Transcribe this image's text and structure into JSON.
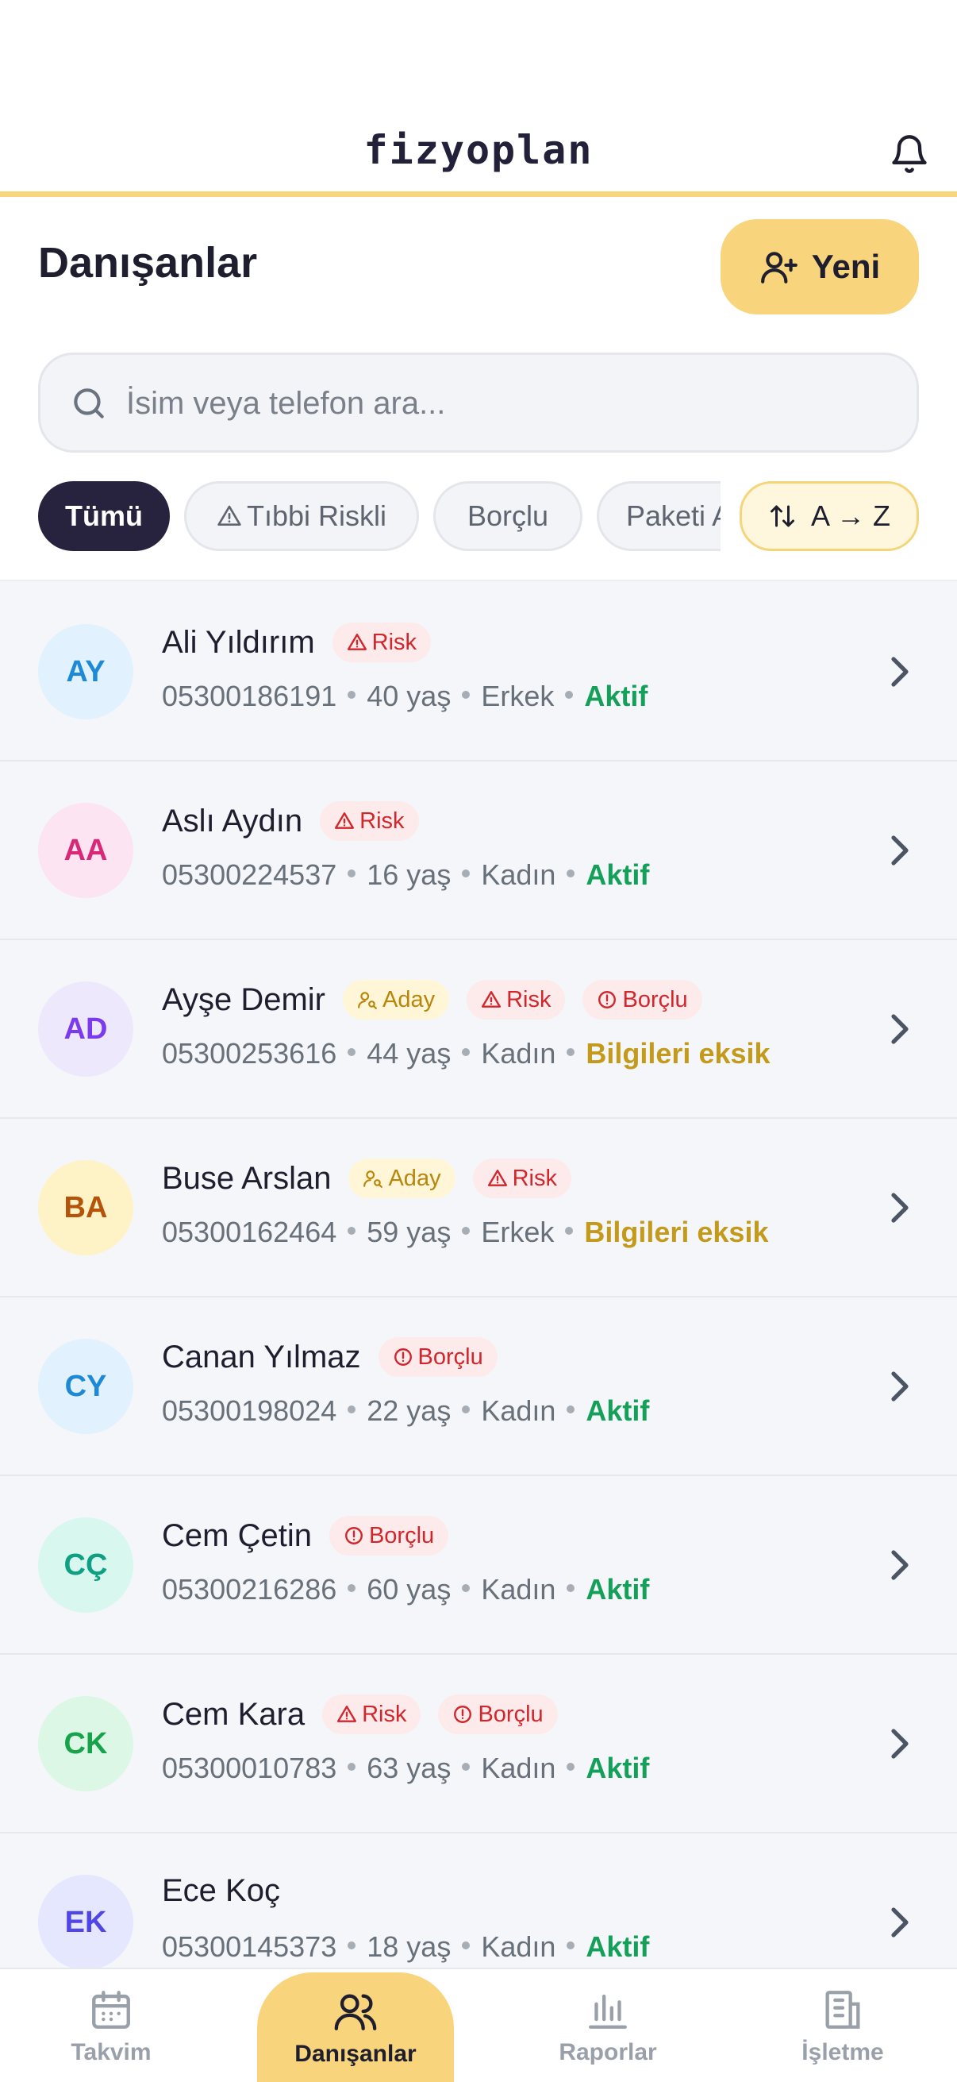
{
  "header": {
    "logo": "fizyoplan"
  },
  "title": "Danışanlar",
  "new_button": {
    "label": "Yeni"
  },
  "search": {
    "placeholder": "İsim veya telefon ara..."
  },
  "filters": [
    {
      "label": "Tümü"
    },
    {
      "label": "Tıbbi Riskli"
    },
    {
      "label": "Borçlu"
    },
    {
      "label": "Paketi Aktif"
    }
  ],
  "sort": {
    "label": "A → Z"
  },
  "clients": [
    {
      "initials": "AY",
      "name": "Ali Yıldırım",
      "phone": "05300186191",
      "age": "40 yaş",
      "gender": "Erkek",
      "status": "Aktif",
      "avatar_bg": "#E1F1FD",
      "avatar_fg": "#1E8AD6"
    },
    {
      "initials": "AA",
      "name": "Aslı Aydın",
      "phone": "05300224537",
      "age": "16 yaş",
      "gender": "Kadın",
      "status": "Aktif",
      "avatar_bg": "#FCE4F2",
      "avatar_fg": "#DB2777"
    },
    {
      "initials": "AD",
      "name": "Ayşe Demir",
      "phone": "05300253616",
      "age": "44 yaş",
      "gender": "Kadın",
      "status": "Bilgileri eksik",
      "avatar_bg": "#EEE8FD",
      "avatar_fg": "#7C3AED"
    },
    {
      "initials": "BA",
      "name": "Buse Arslan",
      "phone": "05300162464",
      "age": "59 yaş",
      "gender": "Erkek",
      "status": "Bilgileri eksik",
      "avatar_bg": "#FEF3C7",
      "avatar_fg": "#B45309"
    },
    {
      "initials": "CY",
      "name": "Canan Yılmaz",
      "phone": "05300198024",
      "age": "22 yaş",
      "gender": "Kadın",
      "status": "Aktif",
      "avatar_bg": "#E1F1FD",
      "avatar_fg": "#1E8AD6"
    },
    {
      "initials": "CÇ",
      "name": "Cem Çetin",
      "phone": "05300216286",
      "age": "60 yaş",
      "gender": "Kadın",
      "status": "Aktif",
      "avatar_bg": "#D7F7EF",
      "avatar_fg": "#0F9F82"
    },
    {
      "initials": "CK",
      "name": "Cem Kara",
      "phone": "05300010783",
      "age": "63 yaş",
      "gender": "Kadın",
      "status": "Aktif",
      "avatar_bg": "#DDF7E6",
      "avatar_fg": "#16A34A"
    },
    {
      "initials": "EK",
      "name": "Ece Koç",
      "phone": "05300145373",
      "age": "18 yaş",
      "gender": "Kadın",
      "status": "Aktif",
      "avatar_bg": "#E4E7FD",
      "avatar_fg": "#4F46E5"
    }
  ],
  "badge_labels": {
    "aday": "Aday",
    "risk": "Risk",
    "borclu": "Borçlu"
  },
  "nav": [
    {
      "label": "Takvim"
    },
    {
      "label": "Danışanlar"
    },
    {
      "label": "Raporlar"
    },
    {
      "label": "İşletme"
    }
  ]
}
